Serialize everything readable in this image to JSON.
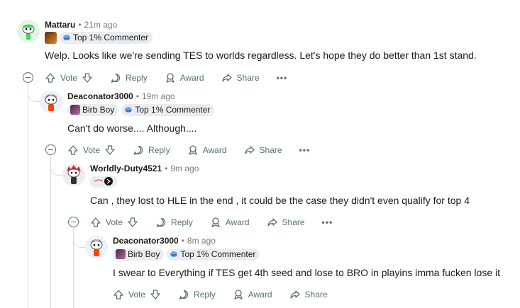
{
  "comments": [
    {
      "username": "Mattaru",
      "time": "21m ago",
      "flairs": [
        "Top 1% Commenter"
      ],
      "body": "Welp. Looks like we're sending TES to worlds regardless. Let's hope they do better than 1st stand."
    },
    {
      "username": "Deaconator3000",
      "time": "19m ago",
      "flairs": [
        "Birb Boy",
        "Top 1% Commenter"
      ],
      "body": "Can't do worse.... Although...."
    },
    {
      "username": "Worldly-Duty4521",
      "time": "9m ago",
      "flairs": [],
      "body": "Can , they lost to HLE in the end , it could be the case they didn't even qualify for top 4"
    },
    {
      "username": "Deaconator3000",
      "time": "8m ago",
      "flairs": [
        "Birb Boy",
        "Top 1% Commenter"
      ],
      "body": "I swear to Everything if TES get 4th seed and lose to BRO in playins imma fucken lose it"
    }
  ],
  "actions": {
    "vote": "Vote",
    "reply": "Reply",
    "award": "Award",
    "share": "Share",
    "more": "•••"
  },
  "colors": {
    "text": "#1a1a1b",
    "muted": "#576f76",
    "flair_bg": "#eaedef",
    "thread_line": "#d7dadc",
    "avatar_green": "#46d160"
  },
  "icons": [
    "upvote-icon",
    "downvote-icon",
    "reply-icon",
    "award-icon",
    "share-icon",
    "collapse-icon",
    "more-icon",
    "snoo-avatar-icon",
    "top-commenter-icon"
  ]
}
